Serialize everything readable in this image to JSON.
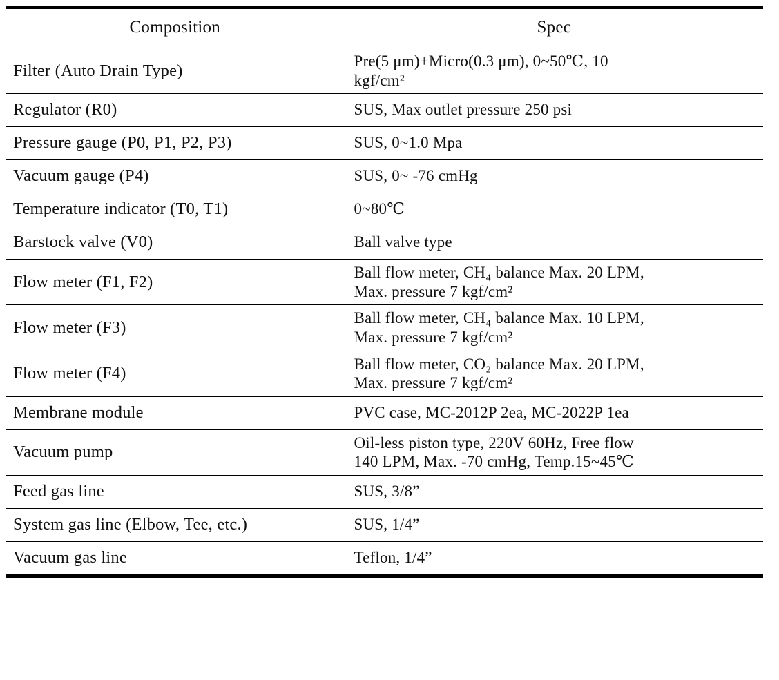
{
  "table": {
    "title_columns": [
      "Composition",
      "Spec"
    ],
    "headers": {
      "composition": "Composition",
      "spec": "Spec"
    },
    "rows": [
      {
        "composition": "Filter  (Auto Drain Type)",
        "spec_lines": [
          "Pre(5  μm)+Micro(0.3  μm), 0~50℃, 10",
          "kgf/cm²"
        ],
        "spec": "Pre(5 μm)+Micro(0.3 μm), 0~50℃, 10 kgf/cm2",
        "tall": true
      },
      {
        "composition": "Regulator  (R0)",
        "spec_lines": [
          "SUS, Max outlet pressure 250 psi"
        ],
        "spec": "SUS, Max outlet pressure 250 psi",
        "tall": false
      },
      {
        "composition": "Pressure gauge  (P0, P1, P2, P3)",
        "spec_lines": [
          "SUS, 0~1.0 Mpa"
        ],
        "spec": "SUS, 0~1.0 Mpa",
        "tall": false
      },
      {
        "composition": "Vacuum gauge  (P4)",
        "spec_lines": [
          "SUS, 0~ -76 cmHg"
        ],
        "spec": "SUS, 0~ -76 cmHg",
        "tall": false
      },
      {
        "composition": "Temperature indicator  (T0, T1)",
        "spec_lines": [
          "0~80℃"
        ],
        "spec": "0~80℃",
        "tall": false
      },
      {
        "composition": "Barstock valve  (V0)",
        "spec_lines": [
          "Ball valve type"
        ],
        "spec": "Ball valve type",
        "tall": false
      },
      {
        "composition": "Flow meter  (F1, F2)",
        "spec_lines": [
          "Ball flow meter, CH₄ balance Max. 20 LPM,",
          "Max. pressure 7 kgf/cm²"
        ],
        "spec": "Ball flow meter, CH4 balance Max. 20 LPM, Max. pressure 7 kgf/cm2",
        "tall": true
      },
      {
        "composition": "Flow meter  (F3)",
        "spec_lines": [
          "Ball flow meter, CH₄ balance Max. 10 LPM,",
          "Max. pressure 7 kgf/cm²"
        ],
        "spec": "Ball flow meter, CH4 balance Max. 10 LPM, Max. pressure 7 kgf/cm2",
        "tall": true
      },
      {
        "composition": "Flow meter  (F4)",
        "spec_lines": [
          "Ball flow meter, CO₂ balance Max. 20 LPM,",
          "Max. pressure 7 kgf/cm²"
        ],
        "spec": "Ball flow meter, CO2 balance Max. 20 LPM, Max. pressure 7 kgf/cm2",
        "tall": true
      },
      {
        "composition": "Membrane module",
        "spec_lines": [
          "PVC case, MC-2012P 2ea, MC-2022P 1ea"
        ],
        "spec": "PVC case, MC-2012P 2ea, MC-2022P 1ea",
        "tall": false
      },
      {
        "composition": "Vacuum pump",
        "spec_lines": [
          "Oil-less piston type, 220V 60Hz, Free flow",
          "140 LPM, Max. -70 cmHg, Temp.15~45℃"
        ],
        "spec": "Oil-less piston type, 220V 60Hz, Free flow 140 LPM, Max. -70 cmHg, Temp.15~45℃",
        "tall": true
      },
      {
        "composition": "Feed gas line",
        "spec_lines": [
          "SUS, 3/8”"
        ],
        "spec": "SUS, 3/8”",
        "tall": false
      },
      {
        "composition": "System gas line  (Elbow, Tee, etc.)",
        "spec_lines": [
          "SUS, 1/4”"
        ],
        "spec": "SUS, 1/4”",
        "tall": false
      },
      {
        "composition": "Vacuum gas line",
        "spec_lines": [
          "Teflon, 1/4”"
        ],
        "spec": "Teflon, 1/4”",
        "tall": false
      }
    ]
  },
  "style": {
    "text_color": "#111111",
    "rule_color": "#000000",
    "background": "#ffffff"
  }
}
